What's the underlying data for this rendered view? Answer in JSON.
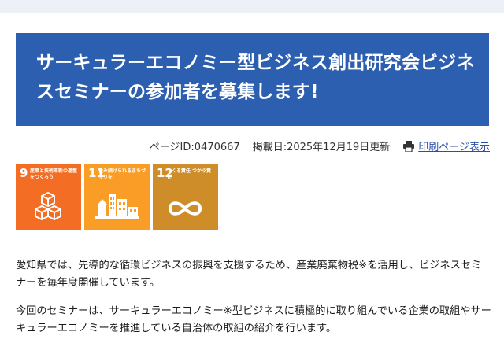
{
  "header": {
    "title": "サーキュラーエコノミー型ビジネス創出研究会ビジネスセミナーの参加者を募集します!"
  },
  "meta": {
    "page_id": "ページID:0470667",
    "updated": "掲載日:2025年12月19日更新",
    "print_label": "印刷ページ表示"
  },
  "sdgs": [
    {
      "number": "9",
      "caption": "産業と技術革新の基盤をつくろう",
      "color": "#f36d25",
      "icon": "cubes-icon"
    },
    {
      "number": "11",
      "caption": "住み続けられるまちづくりを",
      "color": "#f99d26",
      "icon": "city-icon"
    },
    {
      "number": "12",
      "caption": "つくる責任 つかう責任",
      "color": "#cf8d2a",
      "icon": "infinity-icon"
    }
  ],
  "body": {
    "paragraph1": "愛知県では、先導的な循環ビジネスの振興を支援するため、産業廃棄物税※を活用し、ビジネスセミナーを毎年度開催しています。",
    "paragraph2": "今回のセミナーは、サーキュラーエコノミー※型ビジネスに積極的に取り組んでいる企業の取組やサーキュラーエコノミーを推進している自治体の取組の紹介を行います。"
  }
}
